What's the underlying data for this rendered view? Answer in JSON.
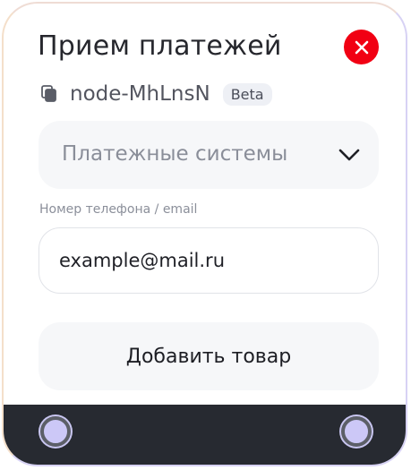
{
  "node": {
    "title": "Прием платежей",
    "id": "node-MhLnsN",
    "badge": "Beta"
  },
  "payment_select": {
    "label": "Платежные системы"
  },
  "contact_field": {
    "label": "Номер телефона / email",
    "value": "example@mail.ru"
  },
  "add_button": {
    "label": "Добавить товар"
  },
  "colors": {
    "close": "#f10013",
    "footer": "#272a31",
    "handle": "#ccc8f7"
  }
}
